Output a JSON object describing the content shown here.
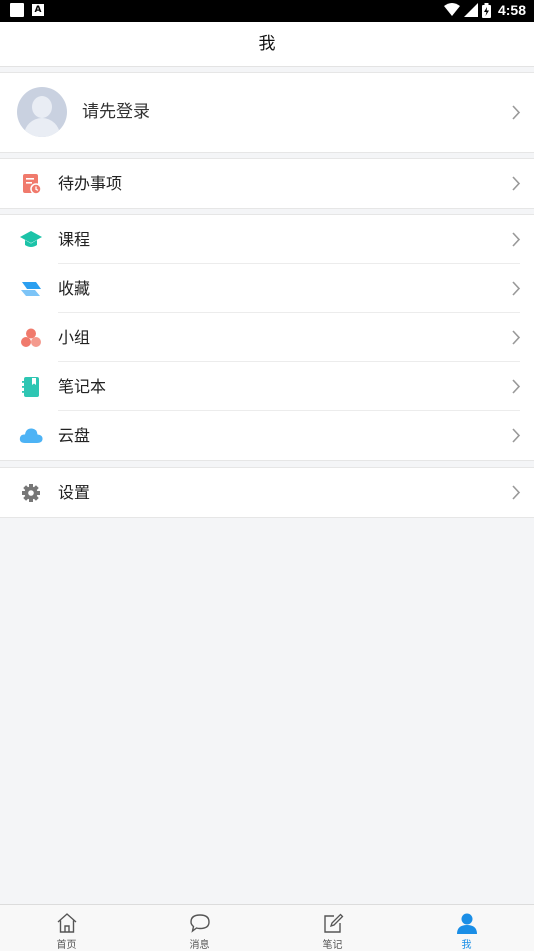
{
  "status_bar": {
    "time": "4:58",
    "icons": [
      "notification-icon",
      "font-icon",
      "wifi-icon",
      "signal-icon",
      "battery-icon"
    ]
  },
  "header": {
    "title": "我"
  },
  "profile": {
    "label": "请先登录",
    "icon": "avatar-placeholder"
  },
  "menu": {
    "todo": {
      "label": "待办事项",
      "icon": "todo-icon",
      "color": "#f07a6c"
    },
    "course": {
      "label": "课程",
      "icon": "graduation-cap-icon",
      "color": "#1cc3a8"
    },
    "favorites": {
      "label": "收藏",
      "icon": "bookmark-stack-icon",
      "color": "#2b9ff0"
    },
    "group": {
      "label": "小组",
      "icon": "group-icon",
      "color": "#f07a6c"
    },
    "notebook": {
      "label": "笔记本",
      "icon": "notebook-icon",
      "color": "#2ec6b3"
    },
    "cloud": {
      "label": "云盘",
      "icon": "cloud-icon",
      "color": "#4db3f5"
    },
    "settings": {
      "label": "设置",
      "icon": "gear-icon",
      "color": "#777777"
    }
  },
  "tabs": [
    {
      "label": "首页",
      "icon": "home-icon",
      "active": false
    },
    {
      "label": "消息",
      "icon": "message-icon",
      "active": false
    },
    {
      "label": "笔记",
      "icon": "note-edit-icon",
      "active": false
    },
    {
      "label": "我",
      "icon": "person-icon",
      "active": true
    }
  ],
  "colors": {
    "accent": "#1a8ee6",
    "background": "#f4f5f7"
  }
}
